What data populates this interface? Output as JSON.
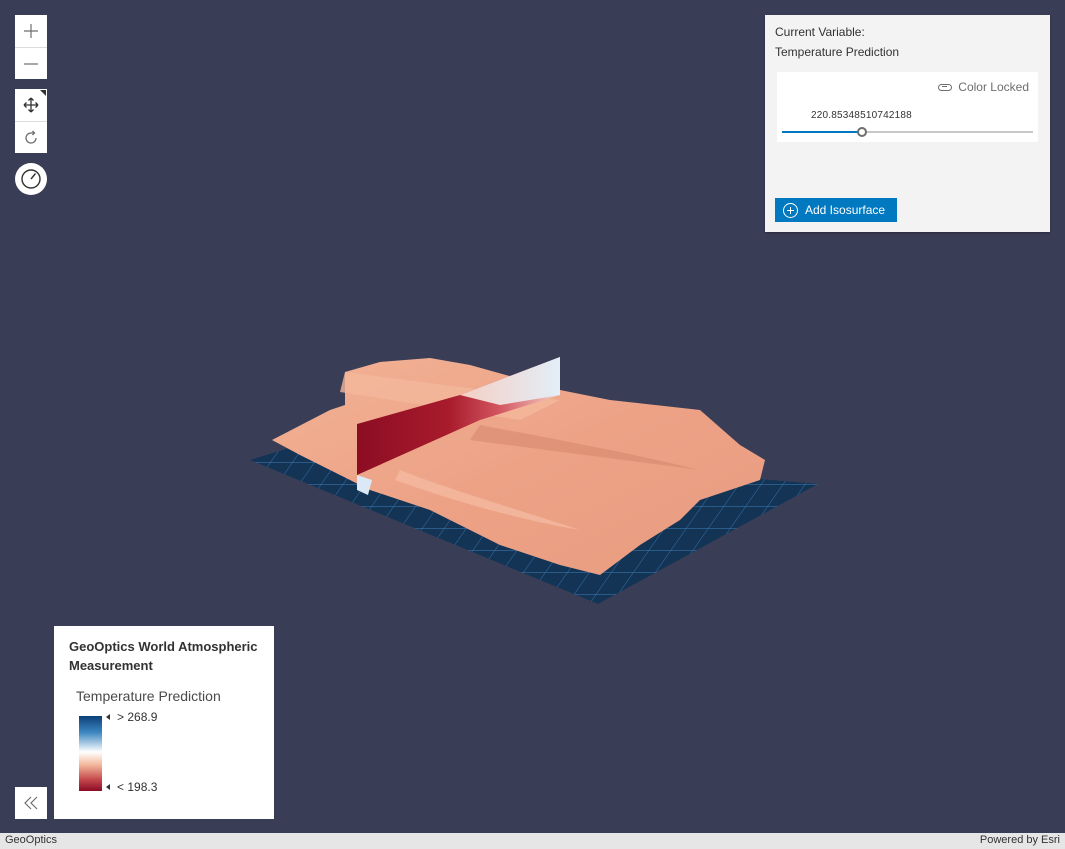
{
  "nav": {
    "zoom_in_icon": "plus-icon",
    "zoom_out_icon": "minus-icon",
    "pan_icon": "move-arrows-icon",
    "rotate_icon": "rotate-icon",
    "compass_icon": "compass-icon"
  },
  "panel": {
    "current_variable_label": "Current Variable:",
    "current_variable_value": "Temperature Prediction",
    "color_locked_label": "Color Locked",
    "slider_value": "220.85348510742188",
    "slider_fraction": 0.32,
    "add_button_label": "Add Isosurface"
  },
  "legend": {
    "title": "GeoOptics World Atmospheric Measurement",
    "subtitle": "Temperature Prediction",
    "max_label": "> 268.9",
    "min_label": "< 198.3",
    "ramp_colors": [
      "#0b3f78",
      "#3d87c0",
      "#ffffff",
      "#f3b89c",
      "#c5474c",
      "#8a0b25"
    ]
  },
  "attribution": {
    "left": "GeoOptics",
    "right": "Powered by Esri"
  },
  "colors": {
    "background": "#3a3d56",
    "accent": "#0079c1",
    "surface": "#efa98d"
  }
}
